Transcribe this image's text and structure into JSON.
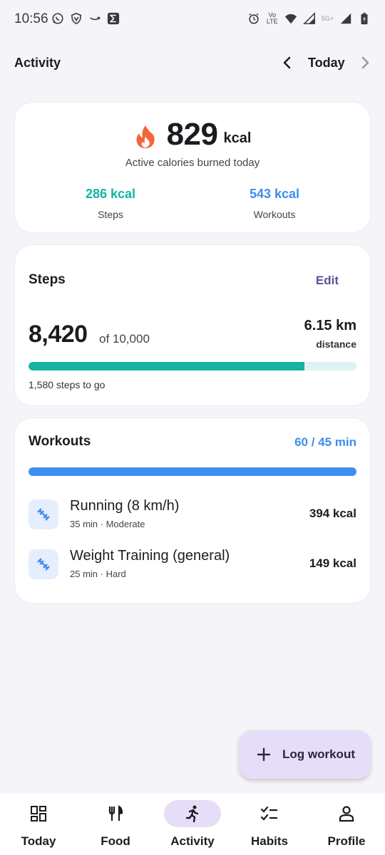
{
  "status_bar": {
    "time": "10:56",
    "network_label": "5G+",
    "volte_label": "Vo LTE"
  },
  "app_bar": {
    "title": "Activity",
    "date_label": "Today"
  },
  "calories": {
    "value": "829",
    "unit": "kcal",
    "subtitle": "Active calories burned today",
    "steps_kcal": "286 kcal",
    "steps_label": "Steps",
    "workouts_kcal": "543 kcal",
    "workouts_label": "Workouts"
  },
  "steps": {
    "title": "Steps",
    "edit_label": "Edit",
    "count": "8,420",
    "goal": "of 10,000",
    "distance": "6.15 km",
    "distance_label": "distance",
    "progress": 0.842,
    "remaining": "1,580 steps to go"
  },
  "workouts": {
    "title": "Workouts",
    "minutes": "60 / 45 min",
    "progress": 1.0,
    "items": [
      {
        "name": "Running (8 km/h)",
        "meta": "35 min · Moderate",
        "kcal": "394 kcal"
      },
      {
        "name": "Weight Training (general)",
        "meta": "25 min · Hard",
        "kcal": "149 kcal"
      }
    ]
  },
  "fab": {
    "label": "Log workout"
  },
  "bottom_nav": {
    "items": [
      {
        "label": "Today",
        "icon": "dashboard-icon"
      },
      {
        "label": "Food",
        "icon": "fork-knife-icon"
      },
      {
        "label": "Activity",
        "icon": "running-icon",
        "active": true
      },
      {
        "label": "Habits",
        "icon": "checklist-icon"
      },
      {
        "label": "Profile",
        "icon": "person-icon"
      }
    ]
  },
  "colors": {
    "steps_accent": "#14b3a2",
    "workouts_accent": "#3d8ef0",
    "active_pill": "#e6def8",
    "flame": "#f4663a"
  }
}
